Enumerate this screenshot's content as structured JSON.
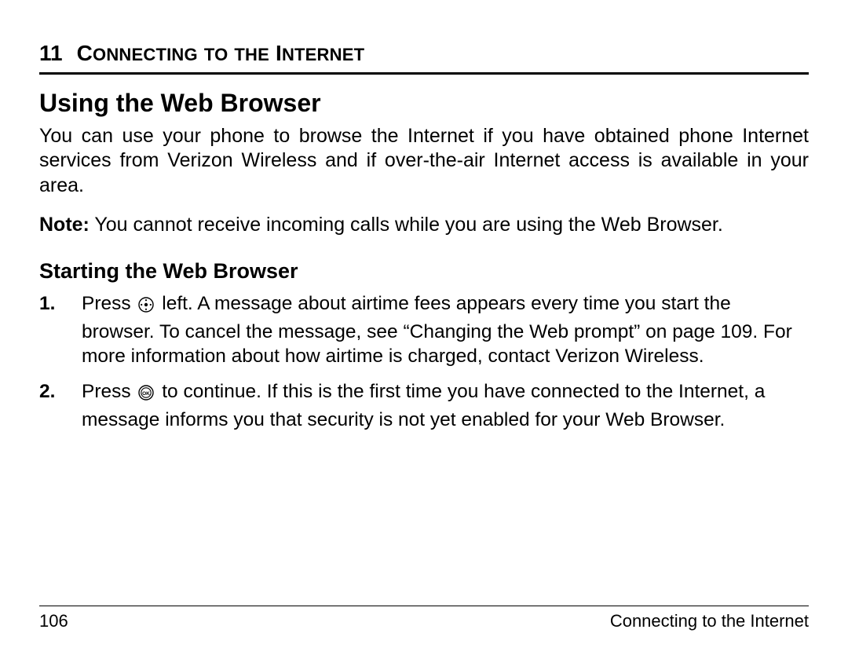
{
  "chapter": {
    "number": "11",
    "title_plain": "Connecting to the Internet"
  },
  "section_h1": "Using the Web Browser",
  "intro_paragraph": "You can use your phone to browse the Internet if you have obtained phone Internet services from Verizon Wireless and if over-the-air Internet access is available in your area.",
  "note": {
    "label": "Note:",
    "text": " You cannot receive incoming calls while you are using the Web Browser."
  },
  "section_h2": "Starting the Web Browser",
  "steps": [
    {
      "num": "1.",
      "pre": "Press ",
      "icon": "nav",
      "post": " left. A message about airtime fees appears every time you start the browser. To cancel the message, see “Changing the Web prompt” on page 109. For more information about how airtime is charged, contact Verizon Wireless."
    },
    {
      "num": "2.",
      "pre": "Press ",
      "icon": "ok",
      "post": " to continue. If this is the first time you have connected to the Internet, a message informs you that security is not yet enabled for your Web Browser."
    }
  ],
  "footer": {
    "page_number": "106",
    "running_title": "Connecting to the Internet"
  }
}
